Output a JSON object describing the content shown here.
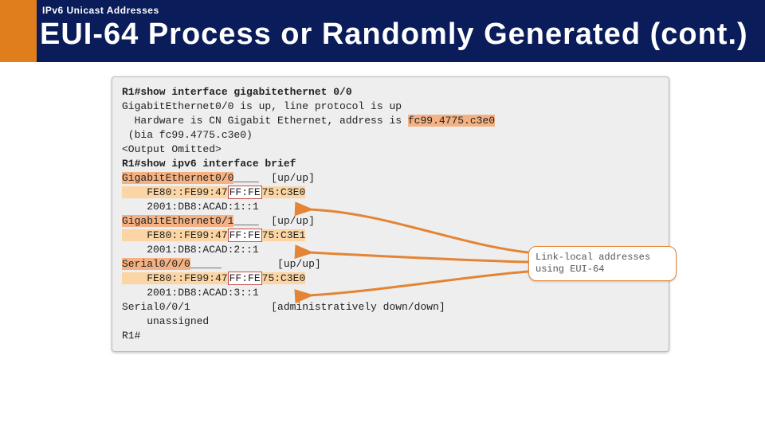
{
  "header": {
    "section": "IPv6 Unicast Addresses",
    "title": "EUI-64 Process or Randomly Generated (cont.)"
  },
  "term": {
    "prompt1_prefix": "R1#",
    "cmd1": "show interface gigabitethernet 0/0",
    "line2_a": "GigabitEthernet0/0 is up, line protocol is up",
    "line3_pre": "  Hardware is CN Gigabit Ethernet, address is ",
    "line3_hl": "fc99.4775.c3e0",
    "line4": " (bia fc99.4775.c3e0)",
    "line5": "<Output Omitted>",
    "blank": "",
    "prompt2_prefix": "R1#",
    "cmd2": "show ipv6 interface brief",
    "gi00_a": "GigabitEthernet0/0",
    "gi00_ul": "____",
    "gi00_b": "[up/up]",
    "fe_pre1": "    FE80::FE99:47",
    "ff_fe": "FF:FE",
    "fe_post1": "75:C3E0",
    "gi00_g": "    2001:DB8:ACAD:1::1",
    "gi01_a": "GigabitEthernet0/1",
    "gi01_ul": "____",
    "gi01_b": "[up/up]",
    "fe_pre2": "    FE80::FE99:47",
    "fe_post2": "75:C3E1",
    "gi01_g": "    2001:DB8:ACAD:2::1",
    "se00_a": "Serial0/0/0",
    "se00_ul": "_____",
    "se00_b": "[up/up]",
    "fe_pre3": "    FE80::FE99:47",
    "fe_post3": "75:C3E0",
    "se00_g": "    2001:DB8:ACAD:3::1",
    "se01_a": "Serial0/0/1             [administratively down/down]",
    "se01_b": "    unassigned",
    "end": "R1#"
  },
  "callout": {
    "text": "Link-local addresses using EUI-64"
  }
}
